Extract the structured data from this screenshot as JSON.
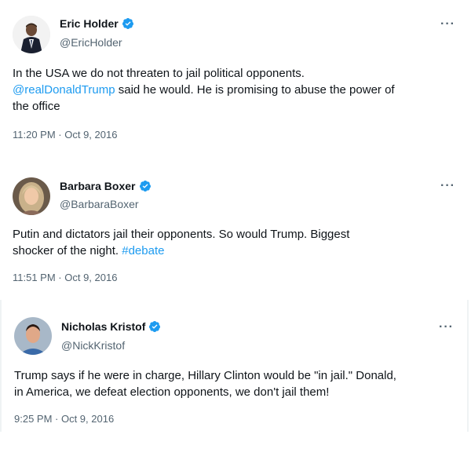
{
  "tweets": [
    {
      "display_name": "Eric Holder",
      "handle": "@EricHolder",
      "text_line1": "In the USA we do not threaten to jail political opponents.",
      "mention": "@realDonaldTrump",
      "text_line2_rest": " said he would. He is promising to abuse the power of",
      "text_line3": "the office",
      "timestamp": "11:20 PM · Oct 9, 2016",
      "more": "···"
    },
    {
      "display_name": "Barbara Boxer",
      "handle": "@BarbaraBoxer",
      "text_line1": "Putin and dictators jail their opponents. So would Trump. Biggest",
      "text_line2_before": "shocker of the night. ",
      "hashtag": "#debate",
      "timestamp": "11:51 PM · Oct 9, 2016",
      "more": "···"
    },
    {
      "display_name": "Nicholas Kristof",
      "handle": "@NickKristof",
      "text_line1": "Trump says if he were in charge, Hillary Clinton would be \"in jail.\" Donald,",
      "text_line2": "in America, we defeat election opponents, we don't jail them!",
      "timestamp": "9:25 PM · Oct 9, 2016",
      "more": "···"
    }
  ],
  "colors": {
    "link": "#1d9bf0",
    "verified": "#1d9bf0",
    "secondary_text": "#536471",
    "primary_text": "#0f1419"
  },
  "icons": {
    "verified": "verified-badge-icon",
    "more": "more-options-icon"
  }
}
